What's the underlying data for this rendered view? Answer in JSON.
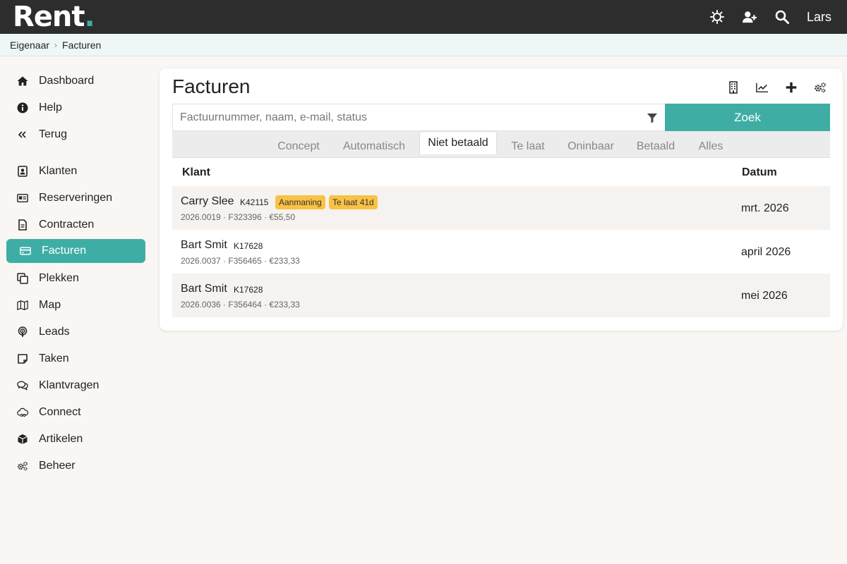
{
  "app": {
    "logo_text": "Rent",
    "logo_dot": ".",
    "accent": "#3eaea5",
    "topbar_bg": "#2d2d2d"
  },
  "topbar": {
    "icons": [
      "sun-icon",
      "add-user-icon",
      "search-icon"
    ],
    "user": "Lars"
  },
  "breadcrumb": {
    "items": [
      "Eigenaar",
      "Facturen"
    ]
  },
  "sidebar": {
    "items": [
      {
        "label": "Dashboard",
        "icon": "home-icon"
      },
      {
        "label": "Help",
        "icon": "info-icon"
      },
      {
        "label": "Terug",
        "icon": "double-chevron-left-icon"
      },
      {
        "label": "Klanten",
        "icon": "contact-card-icon"
      },
      {
        "label": "Reserveringen",
        "icon": "id-card-icon"
      },
      {
        "label": "Contracten",
        "icon": "document-icon"
      },
      {
        "label": "Facturen",
        "icon": "credit-card-icon"
      },
      {
        "label": "Plekken",
        "icon": "copy-icon"
      },
      {
        "label": "Map",
        "icon": "map-icon"
      },
      {
        "label": "Leads",
        "icon": "podcast-icon"
      },
      {
        "label": "Taken",
        "icon": "sticky-note-icon"
      },
      {
        "label": "Klantvragen",
        "icon": "chat-icon"
      },
      {
        "label": "Connect",
        "icon": "cloud-link-icon"
      },
      {
        "label": "Artikelen",
        "icon": "box-icon"
      },
      {
        "label": "Beheer",
        "icon": "gears-icon"
      }
    ],
    "active": "Facturen"
  },
  "main": {
    "title": "Facturen",
    "actions": [
      "building-icon",
      "chart-line-icon",
      "plus-icon",
      "gears-icon"
    ],
    "search": {
      "placeholder": "Factuurnummer, naam, e-mail, status",
      "value": "",
      "button": "Zoek"
    },
    "tabs": [
      "Concept",
      "Automatisch",
      "Niet betaald",
      "Te laat",
      "Oninbaar",
      "Betaald",
      "Alles"
    ],
    "active_tab": "Niet betaald",
    "table": {
      "headers": {
        "client": "Klant",
        "date": "Datum"
      },
      "rows": [
        {
          "name": "Carry Slee",
          "code": "K42115",
          "badges": [
            "Aanmaning",
            "Te laat 41d"
          ],
          "sub": "2026.0019 · F323396 · €55,50",
          "date": "mrt. 2026"
        },
        {
          "name": "Bart Smit",
          "code": "K17628",
          "badges": [],
          "sub": "2026.0037 · F356465 · €233,33",
          "date": "april 2026"
        },
        {
          "name": "Bart Smit",
          "code": "K17628",
          "badges": [],
          "sub": "2026.0036 · F356464 · €233,33",
          "date": "mei 2026"
        }
      ]
    },
    "badge_color": "#f8c244"
  }
}
